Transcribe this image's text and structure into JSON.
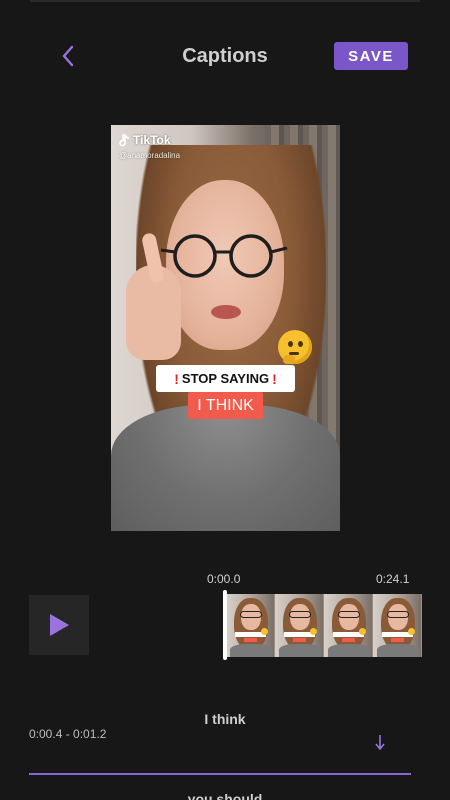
{
  "header": {
    "title": "Captions",
    "save_label": "SAVE"
  },
  "preview": {
    "watermark_brand": "TikTok",
    "watermark_handle": "@anamoradalina",
    "caption_line1": "STOP SAYING",
    "caption_line1_marks": "!",
    "caption_line2": "I THINK"
  },
  "timeline": {
    "start_time": "0:00.0",
    "end_time": "0:24.1",
    "frame_count": 4
  },
  "captions": [
    {
      "text": "I think",
      "range": "0:00.4 - 0:01.2"
    },
    {
      "text": "you should"
    }
  ],
  "colors": {
    "background": "#171717",
    "accent": "#7b56c8",
    "caption_red": "#f25a4c"
  },
  "icons": {
    "back": "chevron-left-icon",
    "play": "play-icon",
    "expand": "arrow-down-icon"
  }
}
